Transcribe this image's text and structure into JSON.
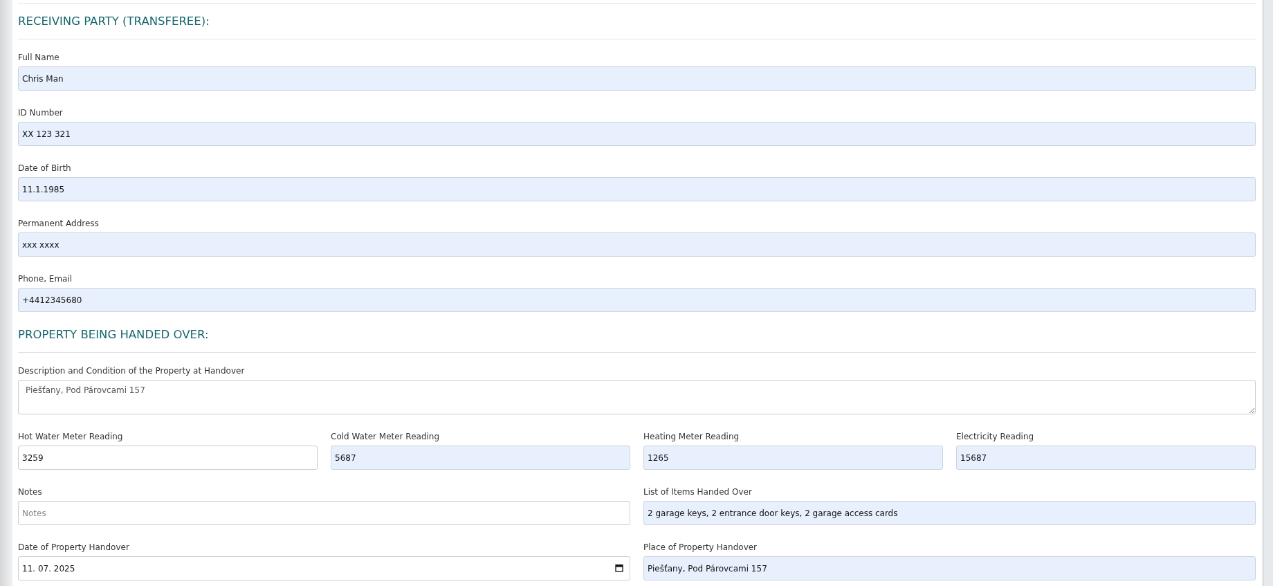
{
  "sections": [
    {
      "heading": "RECEIVING PARTY (TRANSFEREE):",
      "rows": [
        {
          "fields": [
            {
              "label": "Full Name",
              "kind": "text",
              "value": "Chris Man",
              "autofilled": true
            }
          ]
        },
        {
          "fields": [
            {
              "label": "ID Number",
              "kind": "text",
              "value": "XX 123 321",
              "autofilled": true
            }
          ]
        },
        {
          "fields": [
            {
              "label": "Date of Birth",
              "kind": "text",
              "value": "11.1.1985",
              "autofilled": true
            }
          ]
        },
        {
          "fields": [
            {
              "label": "Permanent Address",
              "kind": "text",
              "value": "xxx xxxx",
              "autofilled": true
            }
          ]
        },
        {
          "fields": [
            {
              "label": "Phone, Email",
              "kind": "text",
              "value": "+4412345680",
              "autofilled": true
            }
          ]
        }
      ]
    },
    {
      "heading": "PROPERTY BEING HANDED OVER:",
      "rows": [
        {
          "fields": [
            {
              "label": "Description and Condition of the Property at Handover",
              "kind": "textarea",
              "value": "Piešťany, Pod Párovcami 157",
              "autofilled": false
            }
          ]
        },
        {
          "fields": [
            {
              "label": "Hot Water Meter Reading",
              "kind": "text",
              "value": "3259",
              "autofilled": false
            },
            {
              "label": "Cold Water Meter Reading",
              "kind": "text",
              "value": "5687",
              "autofilled": true
            },
            {
              "label": "Heating Meter Reading",
              "kind": "text",
              "value": "1265",
              "autofilled": true
            },
            {
              "label": "Electricity Reading",
              "kind": "text",
              "value": "15687",
              "autofilled": true
            }
          ]
        },
        {
          "fields": [
            {
              "label": "Notes",
              "kind": "text",
              "placeholder": "Notes",
              "autofilled": false
            },
            {
              "label": "List of Items Handed Over",
              "kind": "text",
              "value": "2 garage keys, 2 entrance door keys, 2 garage access cards",
              "autofilled": true
            }
          ]
        },
        {
          "fields": [
            {
              "label": "Date of Property Handover",
              "kind": "date",
              "value": "11. 07. 2025",
              "autofilled": false
            },
            {
              "label": "Place of Property Handover",
              "kind": "text",
              "value": "Piešťany, Pod Párovcami 157",
              "autofilled": true
            }
          ]
        }
      ]
    }
  ]
}
